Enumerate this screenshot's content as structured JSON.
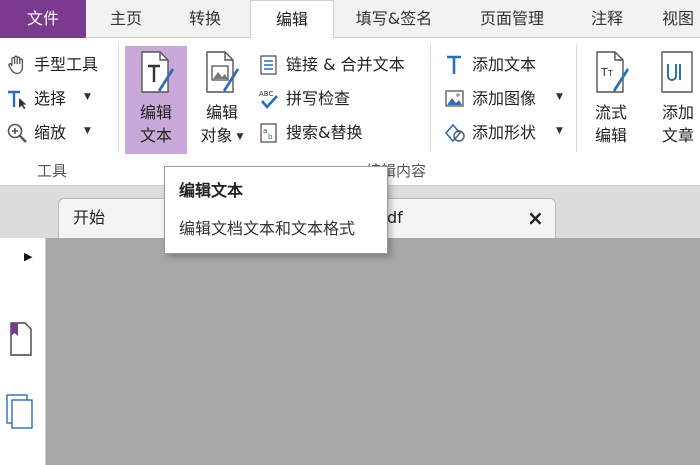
{
  "tabs": [
    {
      "label": "文件"
    },
    {
      "label": "主页"
    },
    {
      "label": "转换"
    },
    {
      "label": "编辑"
    },
    {
      "label": "填写&签名"
    },
    {
      "label": "页面管理"
    },
    {
      "label": "注释"
    },
    {
      "label": "视图"
    }
  ],
  "ribbon": {
    "tools_group": {
      "caption": "工具",
      "hand_tool": "手型工具",
      "select": "选择",
      "zoom": "缩放"
    },
    "edit_group": {
      "caption": "编辑内容",
      "edit_text": {
        "line1": "编辑",
        "line2": "文本"
      },
      "edit_object": {
        "line1": "编辑",
        "line2": "对象"
      },
      "link_merge": "链接 & 合并文本",
      "spell_check": "拼写检查",
      "search_replace": "搜索&替换",
      "add_text": "添加文本",
      "add_image": "添加图像",
      "add_shape": "添加形状",
      "flow_edit": {
        "line1": "流式",
        "line2": "编辑"
      },
      "add_article": {
        "line1": "添加",
        "line2": "文章"
      }
    }
  },
  "tooltip": {
    "title": "编辑文本",
    "description": "编辑文档文本和文本格式"
  },
  "doc_tabs": {
    "start": "开始",
    "doc_suffix": "df",
    "close_glyph": "×"
  },
  "left_panel": {
    "expand_glyph": "▶"
  },
  "colors": {
    "file_tab": "#7a3a8e",
    "active_button": "#c9a9d9",
    "icon_blue": "#2f6db5",
    "canvas": "#a8a8a8"
  }
}
